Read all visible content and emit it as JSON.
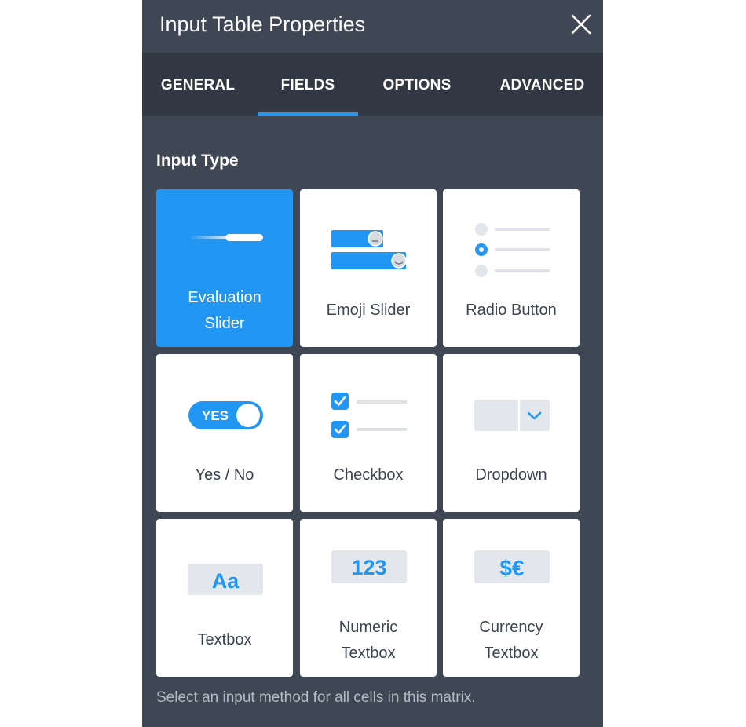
{
  "dialog": {
    "title": "Input Table Properties",
    "close_icon": "close-icon"
  },
  "tabs": [
    {
      "label": "GENERAL",
      "active": false
    },
    {
      "label": "FIELDS",
      "active": true
    },
    {
      "label": "OPTIONS",
      "active": false
    },
    {
      "label": "ADVANCED",
      "active": false
    }
  ],
  "section": {
    "title": "Input Type",
    "hint": "Select an input method for all cells in this matrix."
  },
  "input_types": [
    {
      "label": "Evaluation\nSlider",
      "icon": "evaluation-slider-icon",
      "selected": true
    },
    {
      "label": "Emoji Slider",
      "icon": "emoji-slider-icon",
      "selected": false
    },
    {
      "label": "Radio Button",
      "icon": "radio-button-icon",
      "selected": false
    },
    {
      "label": "Yes / No",
      "icon": "yes-no-toggle-icon",
      "selected": false,
      "icon_text": "YES"
    },
    {
      "label": "Checkbox",
      "icon": "checkbox-icon",
      "selected": false
    },
    {
      "label": "Dropdown",
      "icon": "dropdown-icon",
      "selected": false
    },
    {
      "label": "Textbox",
      "icon": "textbox-icon",
      "selected": false,
      "icon_text": "Aa"
    },
    {
      "label": "Numeric\nTextbox",
      "icon": "numeric-textbox-icon",
      "selected": false,
      "icon_text": "123"
    },
    {
      "label": "Currency\nTextbox",
      "icon": "currency-textbox-icon",
      "selected": false,
      "icon_text": "$€"
    }
  ],
  "colors": {
    "accent": "#2196f3",
    "panel_bg": "#3f4654",
    "tabbar_bg": "#323843"
  }
}
